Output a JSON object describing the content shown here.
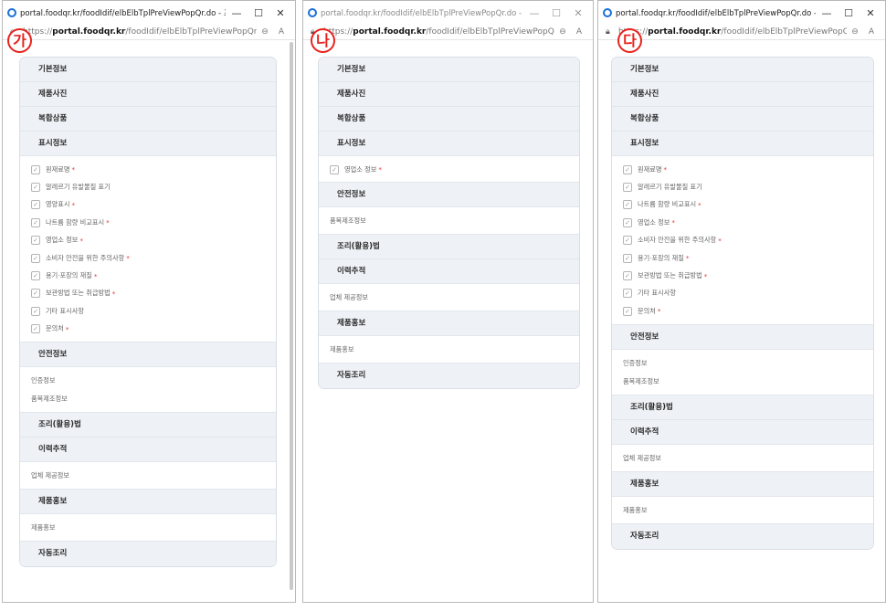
{
  "windows": [
    {
      "badge": "가",
      "title": "portal.foodqr.kr/foodIdif/elbElbTplPreViewPopQr.do - 프로필...",
      "url_prefix": "https://",
      "url_host": "portal.foodqr.kr",
      "url_path": "/foodIdif/elbElbTplPreViewPopQr...",
      "sections": [
        {
          "title": "기본정보"
        },
        {
          "title": "제품사진"
        },
        {
          "title": "복합상품"
        },
        {
          "title": "표시정보",
          "checks": [
            {
              "label": "원재료명",
              "required": true
            },
            {
              "label": "알레르기 유발물질 표기",
              "required": false
            },
            {
              "label": "영양표시",
              "required": true
            },
            {
              "label": "나트륨 함량 비교표시",
              "required": true
            },
            {
              "label": "영업소 정보",
              "required": true
            },
            {
              "label": "소비자 안전을 위한 주의사항",
              "required": true
            },
            {
              "label": "용기·포장의 재질",
              "required": true
            },
            {
              "label": "보관방법 또는 취급방법",
              "required": true
            },
            {
              "label": "기타 표시사항",
              "required": false
            },
            {
              "label": "문의처",
              "required": true
            }
          ]
        },
        {
          "title": "안전정보",
          "texts": [
            "인증정보",
            "품목제조정보"
          ]
        },
        {
          "title": "조리(활용)법"
        },
        {
          "title": "이력추적",
          "texts": [
            "업체 제공정보"
          ]
        },
        {
          "title": "제품홍보",
          "texts": [
            "제품홍보"
          ]
        },
        {
          "title": "자동조리"
        }
      ]
    },
    {
      "badge": "나",
      "title": "portal.foodqr.kr/foodIdif/elbElbTplPreViewPopQr.do - 프로필...",
      "url_prefix": "https://",
      "url_host": "portal.foodqr.kr",
      "url_path": "/foodIdif/elbElbTplPreViewPopQr...",
      "sections": [
        {
          "title": "기본정보"
        },
        {
          "title": "제품사진"
        },
        {
          "title": "복합상품"
        },
        {
          "title": "표시정보",
          "checks": [
            {
              "label": "영업소 정보",
              "required": true
            }
          ]
        },
        {
          "title": "안전정보",
          "texts": [
            "품목제조정보"
          ]
        },
        {
          "title": "조리(활용)법"
        },
        {
          "title": "이력추적",
          "texts": [
            "업체 제공정보"
          ]
        },
        {
          "title": "제품홍보",
          "texts": [
            "제품홍보"
          ]
        },
        {
          "title": "자동조리"
        }
      ]
    },
    {
      "badge": "다",
      "title": "portal.foodqr.kr/foodIdif/elbElbTplPreViewPopQr.do - 프로필...",
      "url_prefix": "https://",
      "url_host": "portal.foodqr.kr",
      "url_path": "/foodIdif/elbElbTplPreViewPopQr...",
      "sections": [
        {
          "title": "기본정보"
        },
        {
          "title": "제품사진"
        },
        {
          "title": "복합상품"
        },
        {
          "title": "표시정보",
          "checks": [
            {
              "label": "원재료명",
              "required": true
            },
            {
              "label": "알레르기 유발물질 표기",
              "required": false
            },
            {
              "label": "나트륨 함량 비교표시",
              "required": true
            },
            {
              "label": "영업소 정보",
              "required": true
            },
            {
              "label": "소비자 안전을 위한 주의사항",
              "required": true
            },
            {
              "label": "용기·포장의 재질",
              "required": true
            },
            {
              "label": "보관방법 또는 취급방법",
              "required": true
            },
            {
              "label": "기타 표시사항",
              "required": false
            },
            {
              "label": "문의처",
              "required": true
            }
          ]
        },
        {
          "title": "안전정보",
          "texts": [
            "인증정보",
            "품목제조정보"
          ]
        },
        {
          "title": "조리(활용)법"
        },
        {
          "title": "이력추적",
          "texts": [
            "업체 제공정보"
          ]
        },
        {
          "title": "제품홍보",
          "texts": [
            "제품홍보"
          ]
        },
        {
          "title": "자동조리"
        }
      ]
    }
  ],
  "icons": {
    "minimize": "minimize-icon",
    "maximize": "maximize-icon",
    "close": "close-icon",
    "lock": "lock-icon",
    "zoom": "zoom-icon",
    "read_aloud": "read-aloud-icon",
    "checkbox": "checkbox-checked-icon"
  },
  "colors": {
    "badge": "#e8221d",
    "required_mark": "#e0383b",
    "section_header_bg": "#eef2f6",
    "favicon": "#1a6fd8"
  }
}
